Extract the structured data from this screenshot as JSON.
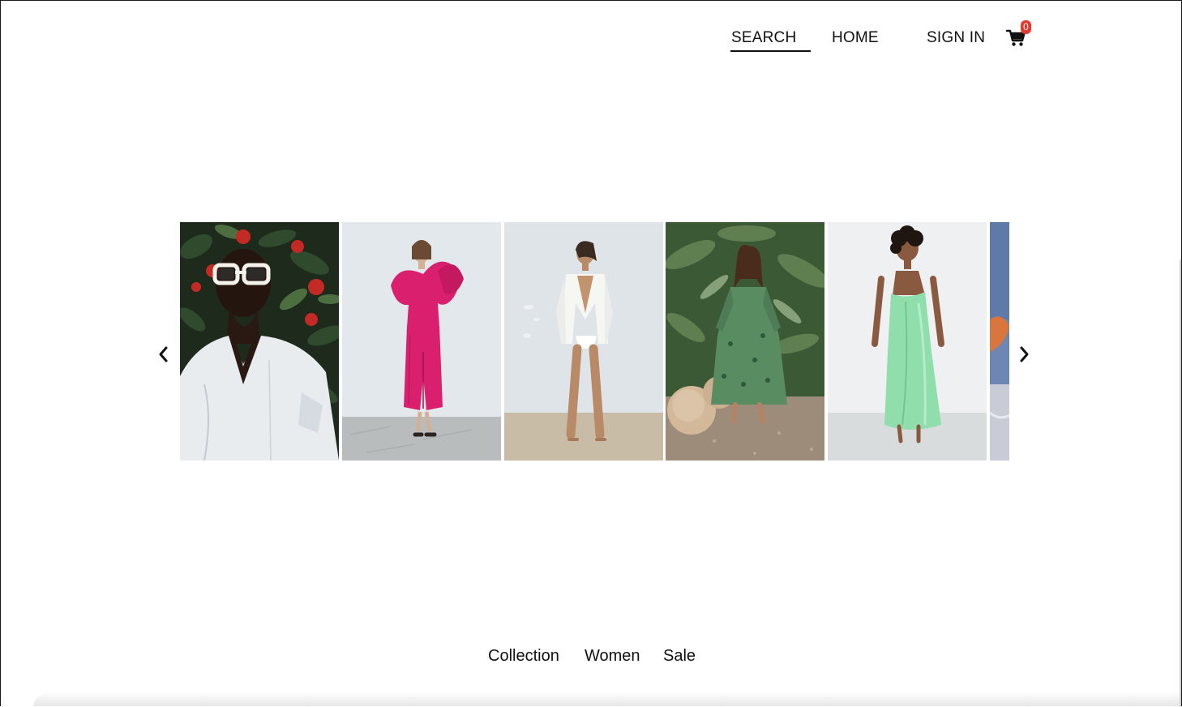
{
  "nav": {
    "search_label": "SEARCH",
    "home_label": "HOME",
    "signin_label": "SIGN IN",
    "cart_icon": "shopping-cart-icon",
    "cart_count": "0",
    "badge_color": "#e8372c"
  },
  "carousel": {
    "prev_icon": "chevron-left-icon",
    "next_icon": "chevron-right-icon"
  },
  "footer": {
    "links": [
      "Collection",
      "Women",
      "Sale"
    ]
  }
}
